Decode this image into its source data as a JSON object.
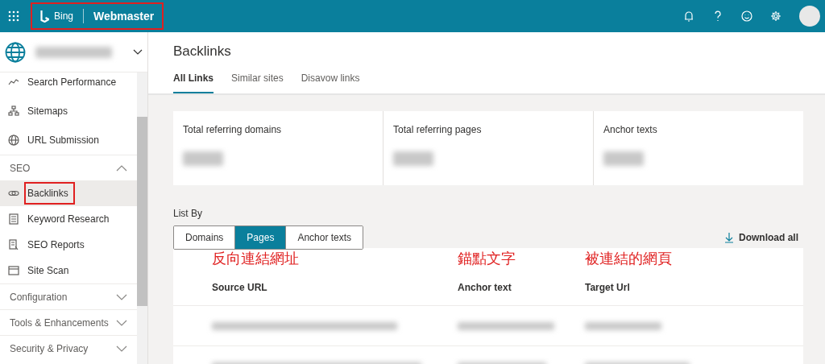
{
  "topbar": {
    "brand": "Bing",
    "product": "Webmaster",
    "brand_highlighted": true
  },
  "sidebar": {
    "site_expanded": false,
    "items": [
      {
        "kind": "link",
        "label": "Search Performance",
        "selected": false,
        "highlighted": false
      },
      {
        "kind": "link",
        "label": "Sitemaps",
        "selected": false,
        "highlighted": false
      },
      {
        "kind": "link",
        "label": "URL Submission",
        "selected": false,
        "highlighted": false
      },
      {
        "kind": "section",
        "label": "SEO",
        "expanded": true
      },
      {
        "kind": "link",
        "label": "Backlinks",
        "selected": true,
        "highlighted": true
      },
      {
        "kind": "link",
        "label": "Keyword Research",
        "selected": false,
        "highlighted": false
      },
      {
        "kind": "link",
        "label": "SEO Reports",
        "selected": false,
        "highlighted": false
      },
      {
        "kind": "link",
        "label": "Site Scan",
        "selected": false,
        "highlighted": false
      },
      {
        "kind": "section",
        "label": "Configuration",
        "expanded": false
      },
      {
        "kind": "section",
        "label": "Tools & Enhancements",
        "expanded": false
      },
      {
        "kind": "section",
        "label": "Security & Privacy",
        "expanded": false
      }
    ]
  },
  "page": {
    "title": "Backlinks",
    "tabs": [
      {
        "label": "All Links",
        "selected": true
      },
      {
        "label": "Similar sites",
        "selected": false
      },
      {
        "label": "Disavow links",
        "selected": false
      }
    ]
  },
  "stats": [
    {
      "label": "Total referring domains"
    },
    {
      "label": "Total referring pages"
    },
    {
      "label": "Anchor texts"
    }
  ],
  "list_by": {
    "label": "List By",
    "options": [
      {
        "label": "Domains",
        "selected": false
      },
      {
        "label": "Pages",
        "selected": true
      },
      {
        "label": "Anchor texts",
        "selected": false
      }
    ],
    "download": "Download all"
  },
  "table": {
    "annotations": [
      "反向連結網址",
      "錨點文字",
      "被連結的網頁"
    ],
    "columns": [
      "Source URL",
      "Anchor text",
      "Target Url"
    ]
  }
}
